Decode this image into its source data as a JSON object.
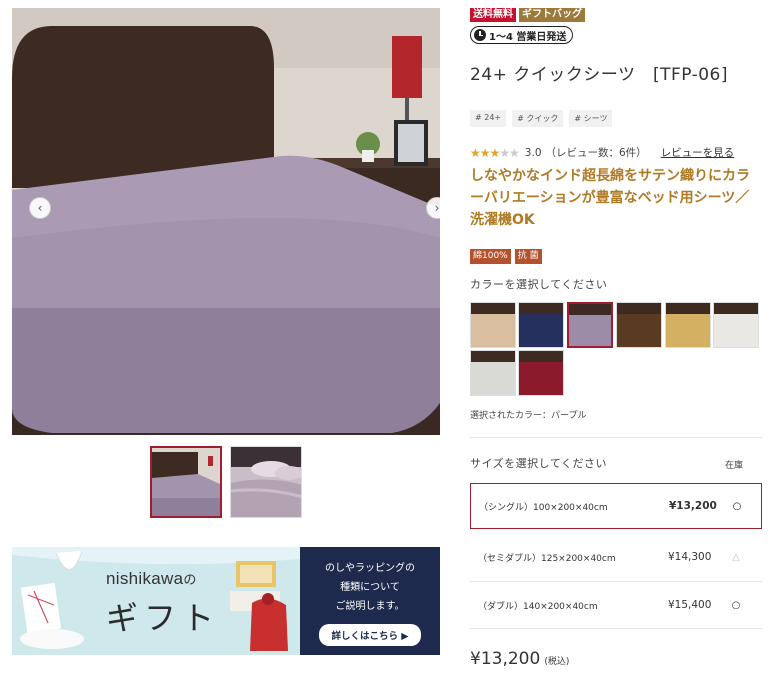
{
  "badges": [
    "送料無料",
    "ギフトバッグ"
  ],
  "shipping": "1〜4 営業日発送",
  "product": {
    "title": "24+ クイックシーツ　[TFP-06]",
    "tags": [
      "# 24+",
      "# クイック",
      "# シーツ"
    ],
    "rating": {
      "score": "3.0",
      "count_text": "（レビュー数：6件）",
      "stars_filled": 3,
      "stars_total": 5
    },
    "review_link": "レビューを見る",
    "catch_copy": "しなやかなインド超長綿をサテン織りにカラーバリエーションが豊富なベッド用シーツ／洗濯機OK",
    "feature_badges": [
      "綿100%",
      "抗 菌"
    ]
  },
  "color": {
    "label": "カラーを選択してください",
    "selected_text": "選択されたカラー：パープル",
    "selected_index": 2,
    "swatches": [
      {
        "name": "beige",
        "color": "#d9bf9f"
      },
      {
        "name": "navy",
        "color": "#26305e"
      },
      {
        "name": "purple",
        "color": "#9d8ca8"
      },
      {
        "name": "brown",
        "color": "#5b3a22"
      },
      {
        "name": "yellow",
        "color": "#d4b063"
      },
      {
        "name": "white",
        "color": "#e9e8e4"
      },
      {
        "name": "light-gray",
        "color": "#d9d9d6"
      },
      {
        "name": "red",
        "color": "#8b1a2c"
      }
    ]
  },
  "size": {
    "label": "サイズを選択してください",
    "stock_label": "在庫",
    "options": [
      {
        "name": "（シングル）100×200×40cm",
        "price": "¥13,200",
        "stock": "○",
        "selected": true
      },
      {
        "name": "（セミダブル）125×200×40cm",
        "price": "¥14,300",
        "stock": "△",
        "selected": false
      },
      {
        "name": "（ダブル）140×200×40cm",
        "price": "¥15,400",
        "stock": "○",
        "selected": false
      }
    ]
  },
  "price": {
    "amount": "¥13,200",
    "tax": "(税込)"
  },
  "gallery": {
    "prev": "‹",
    "next": "›"
  },
  "banner": {
    "brand": "nishikawa",
    "brand_suffix": "の",
    "headline": "ギフト",
    "text_lines": [
      "のしやラッピングの",
      "種類について",
      "ご説明します。"
    ],
    "button": "詳しくはこちら ▶"
  },
  "colors": {
    "accent": "#a01e30",
    "catch": "#b07a25",
    "banner_navy": "#1e2a4d"
  }
}
